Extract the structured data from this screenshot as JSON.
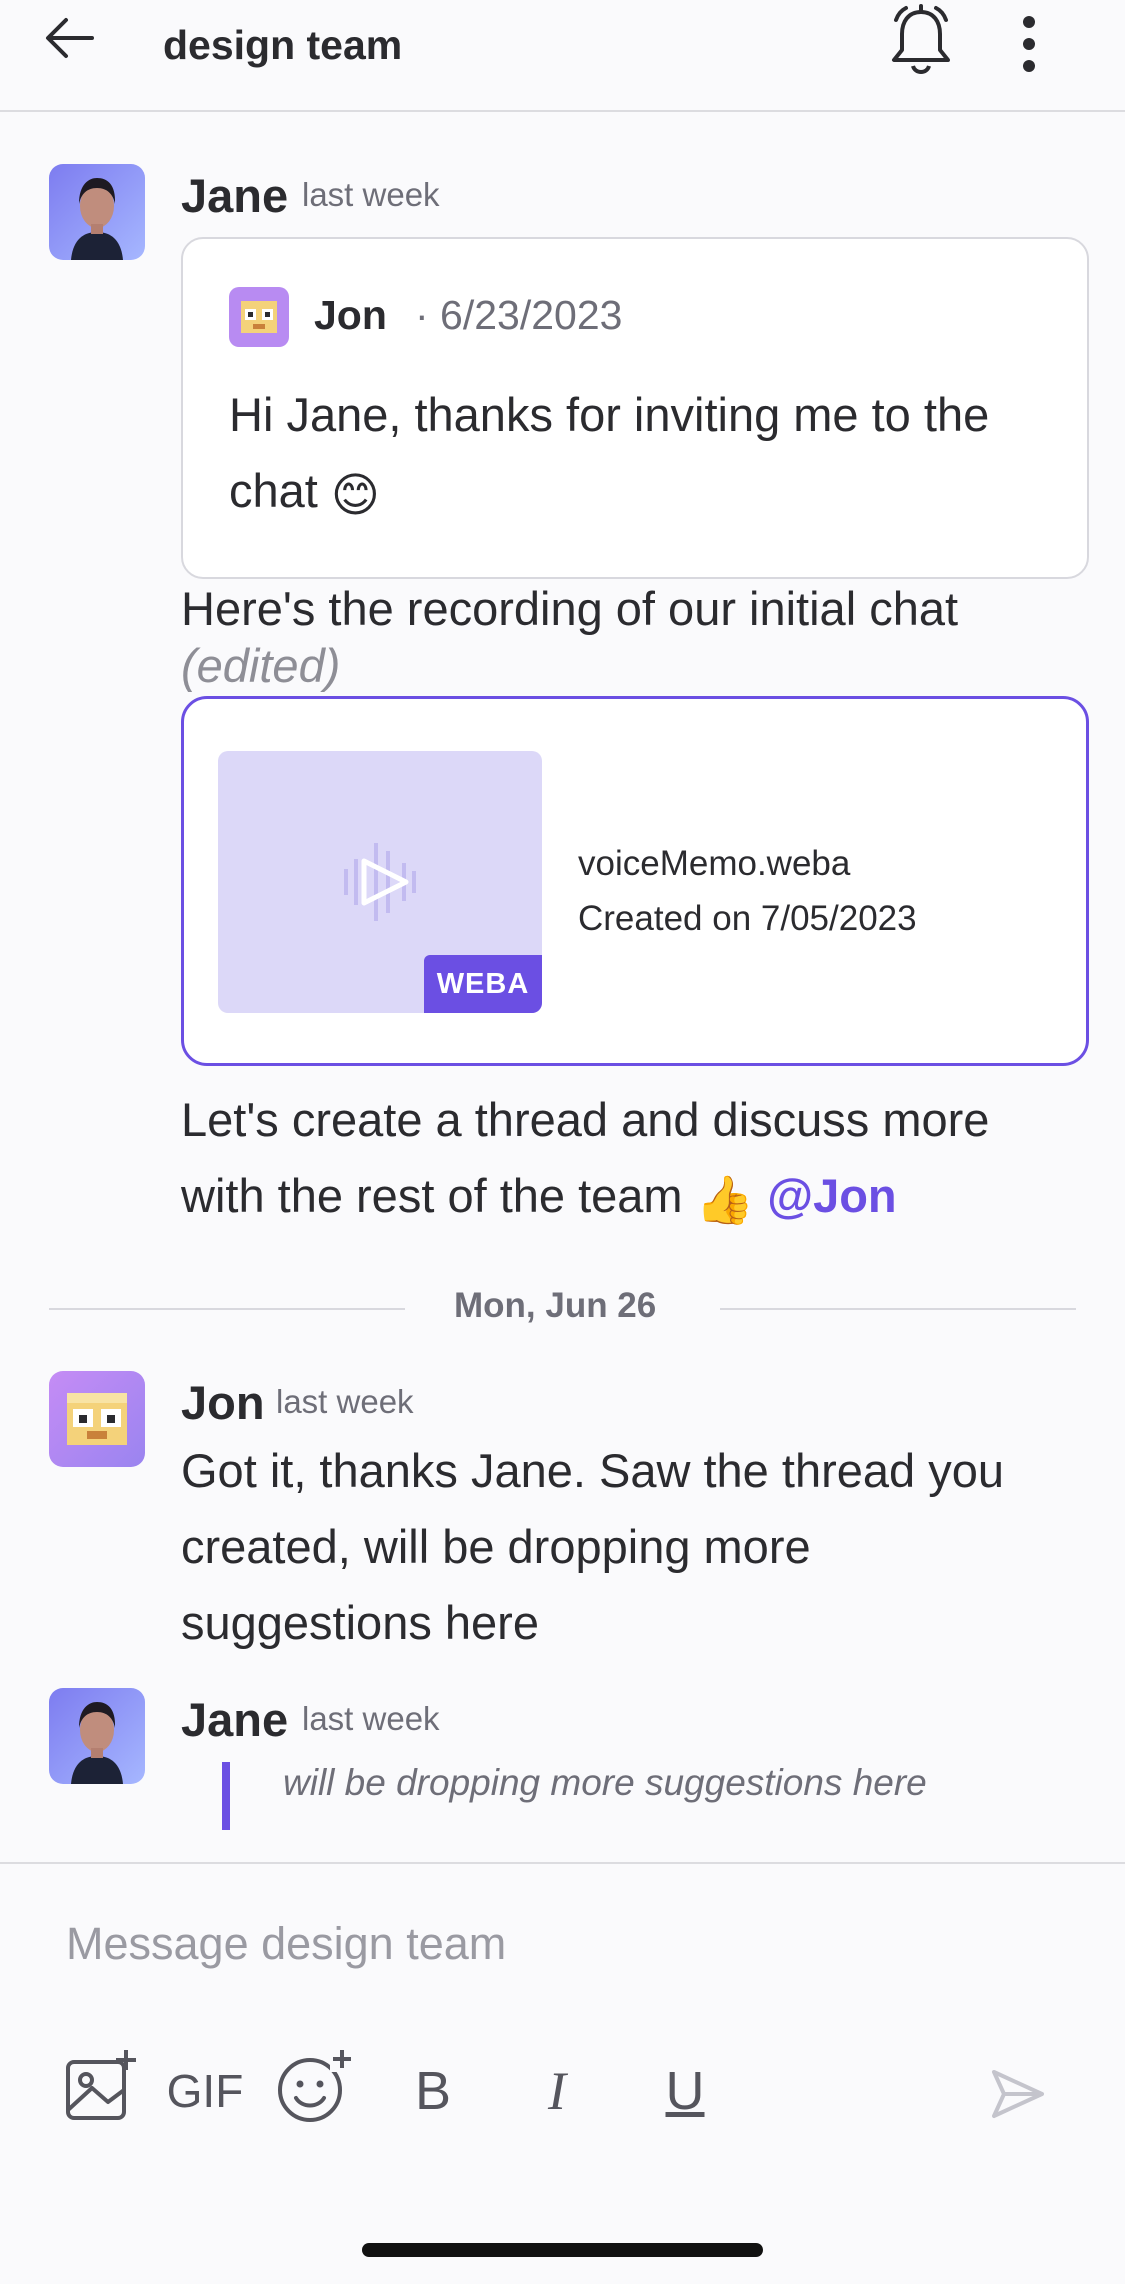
{
  "header": {
    "title": "design team",
    "back_icon": "arrow-left-icon",
    "bell_icon": "bell-icon",
    "more_icon": "more-vertical-icon"
  },
  "messages": [
    {
      "author": "Jane",
      "time": "last week",
      "quote": {
        "author": "Jon",
        "date": "· 6/23/2023",
        "text": "Hi Jane, thanks for inviting me to the chat",
        "emoji": "😊"
      },
      "text": "Here's the recording of our initial chat",
      "edited": "(edited)",
      "attachment": {
        "file_name": "voiceMemo.weba",
        "created": "Created on 7/05/2023",
        "badge": "WEBA"
      },
      "followup_line1": "Let's create a thread and discuss more",
      "followup_line2": "with the rest of the team",
      "followup_emoji": "👍",
      "mention": "@Jon"
    },
    {
      "author": "Jon",
      "time": "last week",
      "lines": [
        "Got it, thanks Jane. Saw the thread you",
        "created, will be dropping more",
        "suggestions here"
      ]
    },
    {
      "author": "Jane",
      "time": "last week",
      "reply_quote": "will be dropping more suggestions here"
    }
  ],
  "date_separator": "Mon, Jun 26",
  "composer": {
    "placeholder": "Message design team",
    "gif_label": "GIF",
    "bold_label": "B",
    "italic_label": "I",
    "underline_label": "U"
  },
  "colors": {
    "accent": "#6b4fe3",
    "background": "#fafafc",
    "border": "#d8d8de"
  }
}
